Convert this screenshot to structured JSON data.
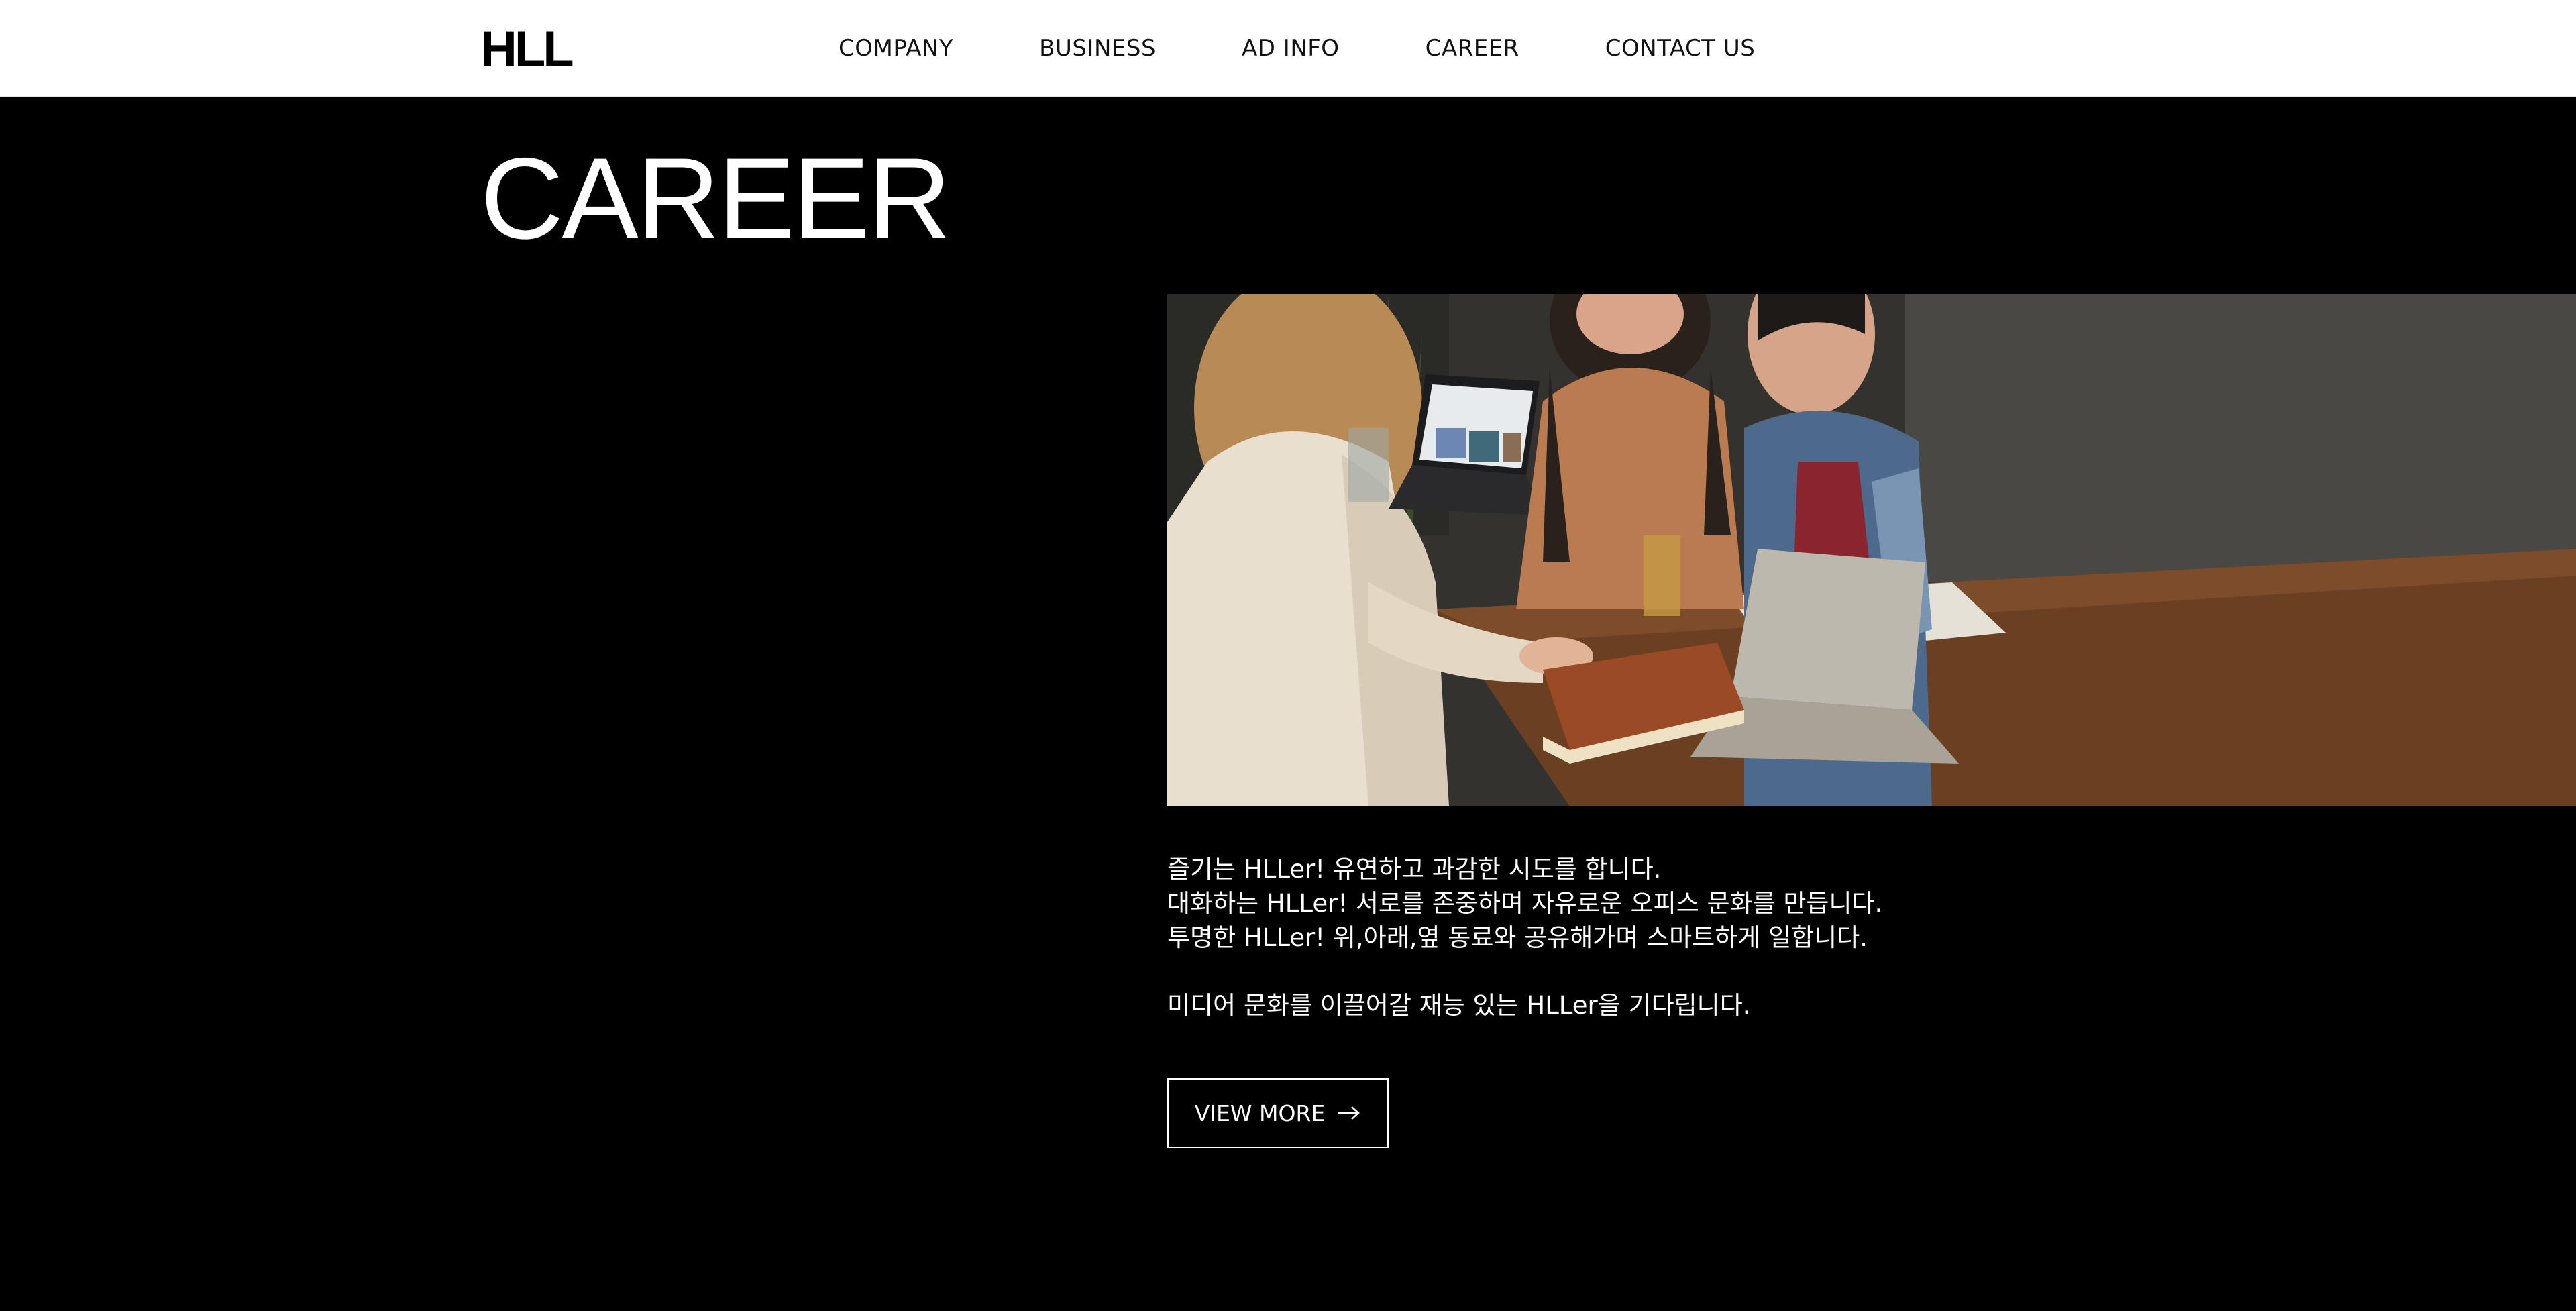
{
  "header": {
    "logo": "HLL",
    "nav": [
      "COMPANY",
      "BUSINESS",
      "AD INFO",
      "CAREER",
      "CONTACT US"
    ]
  },
  "hero": {
    "title": "CAREER"
  },
  "photo": {
    "icon": "team-meeting-photo"
  },
  "content": {
    "lines": [
      "즐기는 HLLer! 유연하고 과감한 시도를 합니다.",
      "대화하는 HLLer! 서로를 존중하며 자유로운 오피스 문화를 만듭니다.",
      "투명한 HLLer! 위,아래,옆 동료와 공유해가며 스마트하게 일합니다."
    ],
    "closing": "미디어 문화를 이끌어갈 재능 있는 HLLer을 기다립니다."
  },
  "cta": {
    "label": "VIEW MORE",
    "icon": "arrow-right-icon"
  },
  "colors": {
    "background": "#000000",
    "header": "#ffffff",
    "text": "#ffffff"
  }
}
